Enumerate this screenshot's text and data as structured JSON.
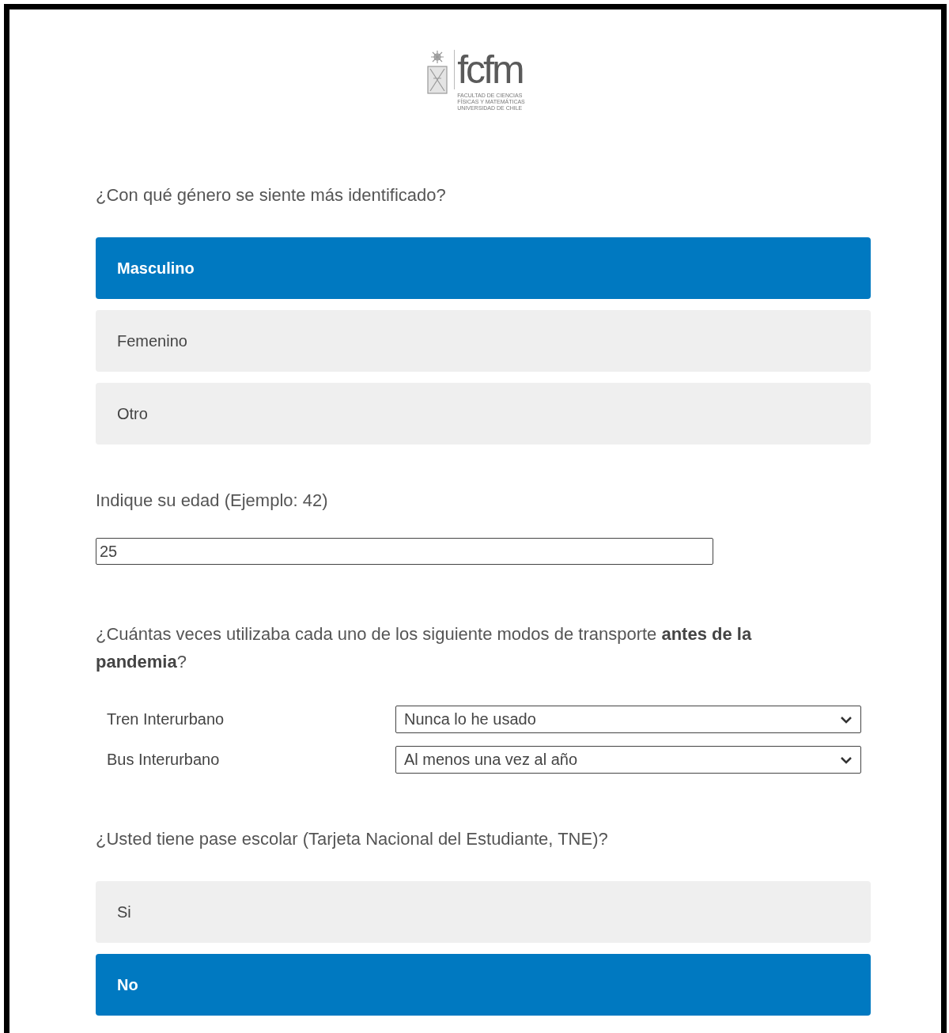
{
  "logo": {
    "mark": "fcfm",
    "subtitle": [
      "FACULTAD DE CIENCIAS",
      "FÍSICAS Y MATEMÁTICAS",
      "UNIVERSIDAD DE CHILE"
    ]
  },
  "questions": [
    {
      "kind": "choice",
      "text": "¿Con qué género se siente más identificado?",
      "options": [
        {
          "label": "Masculino",
          "selected": true
        },
        {
          "label": "Femenino",
          "selected": false
        },
        {
          "label": "Otro",
          "selected": false
        }
      ]
    },
    {
      "kind": "text",
      "text": "Indique su edad (Ejemplo: 42)",
      "value": "25"
    },
    {
      "kind": "matrix",
      "text": "¿Cuántas veces utilizaba cada uno de los siguiente modos de transporte **antes de la pandemia**?",
      "rows": [
        {
          "label": "Tren Interurbano",
          "value": "Nunca lo he usado"
        },
        {
          "label": "Bus Interurbano",
          "value": "Al menos una vez al año"
        }
      ]
    },
    {
      "kind": "choice",
      "text": "¿Usted tiene pase escolar (Tarjeta Nacional del Estudiante, TNE)?",
      "options": [
        {
          "label": "Si",
          "selected": false
        },
        {
          "label": "No",
          "selected": true
        }
      ]
    }
  ]
}
